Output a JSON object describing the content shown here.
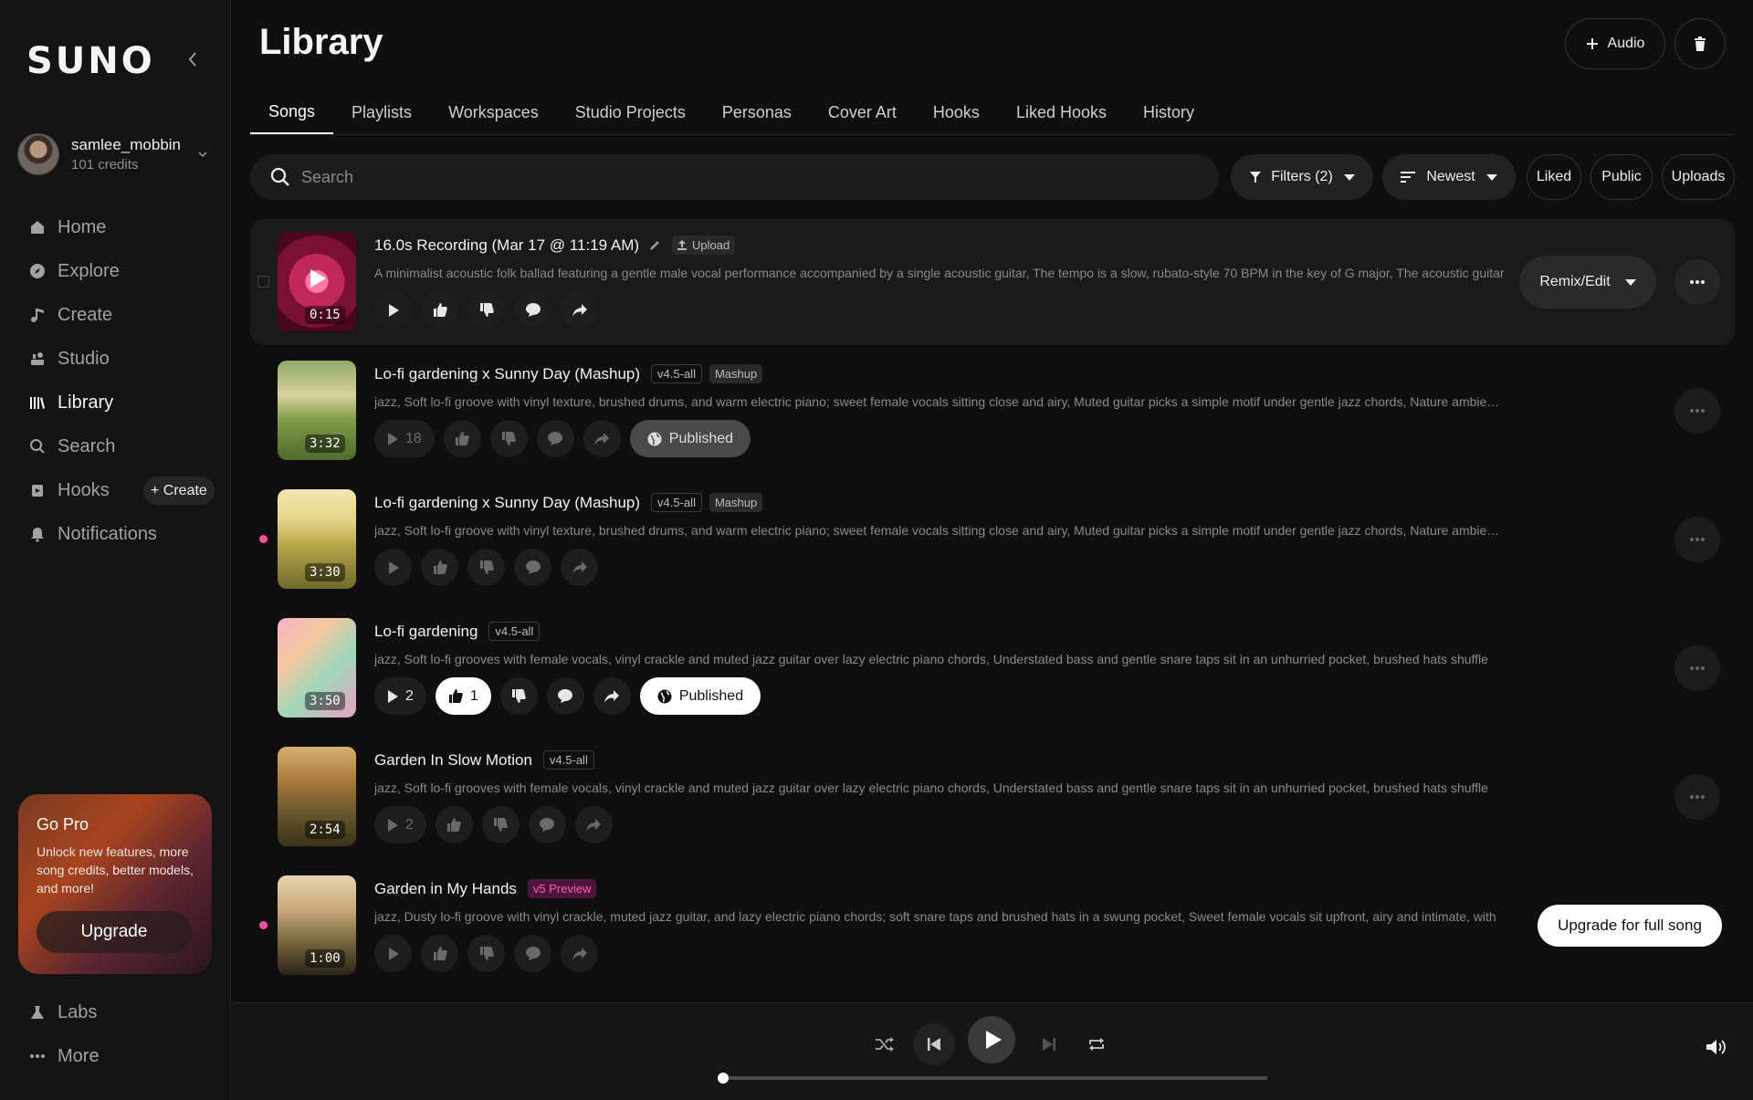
{
  "brand": {
    "logo": "SUNO"
  },
  "user": {
    "name": "samlee_mobbin",
    "credits": "101 credits"
  },
  "nav": {
    "home": "Home",
    "explore": "Explore",
    "create": "Create",
    "studio": "Studio",
    "library": "Library",
    "search": "Search",
    "hooks": "Hooks",
    "hooks_create": "+ Create",
    "notifications": "Notifications",
    "labs": "Labs",
    "more": "More"
  },
  "gopro": {
    "title": "Go Pro",
    "text": "Unlock new features, more song credits, better models, and more!",
    "button": "Upgrade"
  },
  "header": {
    "title": "Library",
    "add_audio": "Audio"
  },
  "tabs": [
    "Songs",
    "Playlists",
    "Workspaces",
    "Studio Projects",
    "Personas",
    "Cover Art",
    "Hooks",
    "Liked Hooks",
    "History"
  ],
  "toolbar": {
    "search_placeholder": "Search",
    "filters": "Filters (2)",
    "sort": "Newest",
    "liked": "Liked",
    "public": "Public",
    "uploads": "Uploads"
  },
  "songs": [
    {
      "title": "16.0s Recording (Mar 17 @ 11:19 AM)",
      "tag": "Upload",
      "desc": "A minimalist acoustic folk ballad featuring a gentle male vocal performance accompanied by a single acoustic guitar, The tempo is a slow, rubato-style 70 BPM in the key of G major, The acoustic guitar",
      "duration": "0:15",
      "remix": "Remix/Edit"
    },
    {
      "title": "Lo-fi gardening x Sunny Day (Mashup)",
      "tag1": "v4.5-all",
      "tag2": "Mashup",
      "desc": "jazz, Soft lo-fi groove with vinyl texture, brushed drums, and warm electric piano; sweet female vocals sitting close and airy, Muted guitar picks a simple motif under gentle jazz chords, Nature ambience",
      "duration": "3:32",
      "plays": "18",
      "published": "Published"
    },
    {
      "title": "Lo-fi gardening x Sunny Day (Mashup)",
      "tag1": "v4.5-all",
      "tag2": "Mashup",
      "desc": "jazz, Soft lo-fi groove with vinyl texture, brushed drums, and warm electric piano; sweet female vocals sitting close and airy, Muted guitar picks a simple motif under gentle jazz chords, Nature ambience",
      "duration": "3:30"
    },
    {
      "title": "Lo-fi gardening",
      "tag1": "v4.5-all",
      "desc": "jazz, Soft lo-fi grooves with female vocals, vinyl crackle and muted jazz guitar over lazy electric piano chords, Understated bass and gentle snare taps sit in an unhurried pocket, brushed hats shuffle",
      "duration": "3:50",
      "plays": "2",
      "likes": "1",
      "published": "Published"
    },
    {
      "title": "Garden In Slow Motion",
      "tag1": "v4.5-all",
      "desc": "jazz, Soft lo-fi grooves with female vocals, vinyl crackle and muted jazz guitar over lazy electric piano chords, Understated bass and gentle snare taps sit in an unhurried pocket, brushed hats shuffle",
      "duration": "2:54",
      "plays": "2"
    },
    {
      "title": "Garden in My Hands",
      "tag1": "v5 Preview",
      "desc": "jazz, Dusty lo-fi groove with vinyl crackle, muted jazz guitar, and lazy electric piano chords; soft snare taps and brushed hats in a swung pocket, Sweet female vocals sit upfront, airy and intimate, with",
      "duration": "1:00",
      "upgrade": "Upgrade for full song"
    }
  ],
  "player": {
    "progress": 0.0
  },
  "colors": {
    "accent_pink": "#ff4f9a",
    "v5_tag": "#ff5fb4",
    "background": "#0f0f0f"
  }
}
